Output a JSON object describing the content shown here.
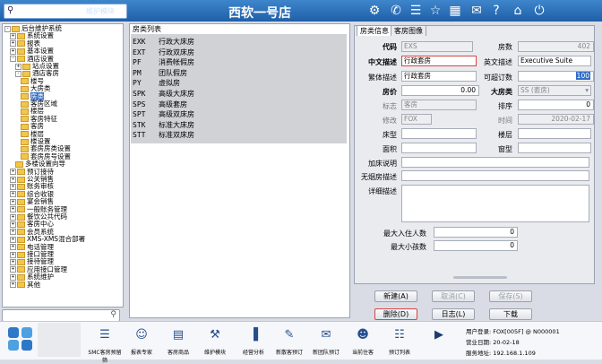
{
  "topbar": {
    "module_label": "维护模块",
    "app_title": "西软一号店",
    "icons": [
      "tools-icon",
      "phone-icon",
      "menu-icon",
      "star-icon",
      "grid-icon",
      "mail-icon",
      "help-icon",
      "home-icon",
      "power-icon"
    ]
  },
  "tree": {
    "items": [
      {
        "label": "后台维护系统",
        "depth": 0,
        "exp": "-"
      },
      {
        "label": "系统设置",
        "depth": 1,
        "exp": "+"
      },
      {
        "label": "报表",
        "depth": 1,
        "exp": "+"
      },
      {
        "label": "基本设置",
        "depth": 1,
        "exp": "+"
      },
      {
        "label": "酒店设置",
        "depth": 1,
        "exp": "-"
      },
      {
        "label": "站点设置",
        "depth": 2,
        "exp": "+"
      },
      {
        "label": "酒店客房",
        "depth": 2,
        "exp": "-"
      },
      {
        "label": "楼号",
        "depth": 3,
        "exp": ""
      },
      {
        "label": "大房类",
        "depth": 3,
        "exp": ""
      },
      {
        "label": "房类",
        "depth": 3,
        "exp": "",
        "selected": true
      },
      {
        "label": "客房区域",
        "depth": 3,
        "exp": ""
      },
      {
        "label": "楼层",
        "depth": 3,
        "exp": ""
      },
      {
        "label": "客房特征",
        "depth": 3,
        "exp": ""
      },
      {
        "label": "客房",
        "depth": 3,
        "exp": ""
      },
      {
        "label": "楼层",
        "depth": 3,
        "exp": ""
      },
      {
        "label": "楼设置",
        "depth": 3,
        "exp": ""
      },
      {
        "label": "套房房类设置",
        "depth": 3,
        "exp": ""
      },
      {
        "label": "套房房号设置",
        "depth": 3,
        "exp": ""
      },
      {
        "label": "多楼设置向导",
        "depth": 2,
        "exp": ""
      },
      {
        "label": "预订接待",
        "depth": 1,
        "exp": "+"
      },
      {
        "label": "公关销售",
        "depth": 1,
        "exp": "+"
      },
      {
        "label": "账务审核",
        "depth": 1,
        "exp": "+"
      },
      {
        "label": "综合收银",
        "depth": 1,
        "exp": "+"
      },
      {
        "label": "宴会销售",
        "depth": 1,
        "exp": "+"
      },
      {
        "label": "一般账务管理",
        "depth": 1,
        "exp": "+"
      },
      {
        "label": "餐饮公共代码",
        "depth": 1,
        "exp": "+"
      },
      {
        "label": "客房中心",
        "depth": 1,
        "exp": "+"
      },
      {
        "label": "会员系统",
        "depth": 1,
        "exp": "+"
      },
      {
        "label": "XMS-XMS混合部署",
        "depth": 1,
        "exp": "+"
      },
      {
        "label": "电话管理",
        "depth": 1,
        "exp": "+"
      },
      {
        "label": "接口管理",
        "depth": 1,
        "exp": "+"
      },
      {
        "label": "接待管理",
        "depth": 1,
        "exp": "+"
      },
      {
        "label": "应用接口管理",
        "depth": 1,
        "exp": "+"
      },
      {
        "label": "系统维护",
        "depth": 1,
        "exp": "+"
      },
      {
        "label": "其他",
        "depth": 1,
        "exp": "+"
      }
    ]
  },
  "list": {
    "title": "房类列表",
    "rows": [
      {
        "code": "EXK",
        "name": "行政大床房"
      },
      {
        "code": "EXT",
        "name": "行政双床房"
      },
      {
        "code": "PF",
        "name": "消费帐假房"
      },
      {
        "code": "PM",
        "name": "团队假房"
      },
      {
        "code": "PY",
        "name": "虚拟房"
      },
      {
        "code": "SPK",
        "name": "高级大床房"
      },
      {
        "code": "SPS",
        "name": "高级套房"
      },
      {
        "code": "SPT",
        "name": "高级双床房"
      },
      {
        "code": "STK",
        "name": "标准大床房"
      },
      {
        "code": "STT",
        "name": "标准双床房"
      }
    ]
  },
  "detail": {
    "tabs": [
      "房类信息",
      "客房图像"
    ],
    "labels": {
      "code": "代码",
      "rooms": "房数",
      "cn_desc": "中文描述",
      "en_desc": "英文描述",
      "trad_desc": "繁体描述",
      "over": "可超订数",
      "price": "房价",
      "big_type": "大房类",
      "flag": "标志",
      "sort": "排序",
      "modify": "修改",
      "time": "时间",
      "bed": "床型",
      "floor": "楼层",
      "area": "面积",
      "window": "窗型",
      "extra_bed": "加床说明",
      "no_extra": "无烟房描述",
      "detail": "详细描述",
      "max_adults": "最大入住人数",
      "max_children": "最大小孩数"
    },
    "values": {
      "code": "EXS",
      "rooms": "402",
      "cn_desc": "行政套房",
      "en_desc": "Executive Suite",
      "trad_desc": "行政套房",
      "over": "100",
      "price": "0.00",
      "big_type": "SS  (套房)",
      "flag": "客房",
      "sort": "0",
      "modify": "FOX",
      "time": "2020-02-17",
      "max_adults": "0",
      "max_children": "0"
    }
  },
  "actions": {
    "new": "新建(A)",
    "cancel": "取消(C)",
    "save": "保存(S)",
    "delete": "删除(D)",
    "log": "日志(L)",
    "next": "下载"
  },
  "bottom": {
    "items": [
      "SMC客房预留筛",
      "报表专家",
      "客房商品",
      "维护模块",
      "经营分析",
      "新散客预订",
      "新团队预订",
      "当前住客",
      "预订列表"
    ],
    "user_label": "用户登录:",
    "user_value": "FOX[005F] @ N000001",
    "biz_label": "营业日期:",
    "biz_value": "20-02-18",
    "srv_label": "服务地址:",
    "srv_value": "192.168.1.109"
  }
}
